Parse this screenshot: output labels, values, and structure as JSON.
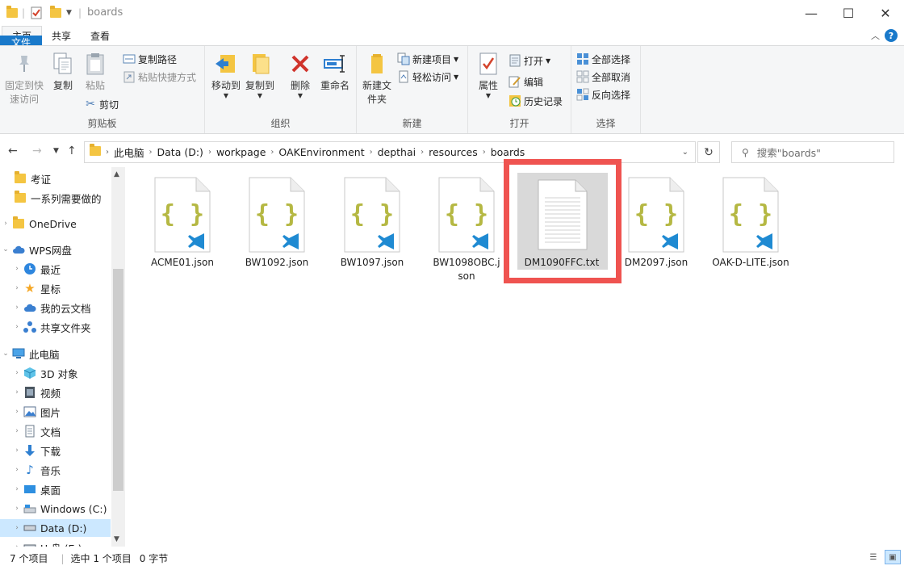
{
  "window": {
    "title": "boards",
    "minimize": "—",
    "maximize": "☐",
    "close": "✕"
  },
  "tabs": [
    {
      "label": "文件"
    },
    {
      "label": "主页"
    },
    {
      "label": "共享"
    },
    {
      "label": "查看"
    }
  ],
  "ribbon": {
    "clipboard": {
      "label": "剪贴板",
      "pin": "固定到快速访问",
      "copy": "复制",
      "paste": "粘贴",
      "copy_path": "复制路径",
      "paste_shortcut": "粘贴快捷方式",
      "cut": "剪切"
    },
    "organize": {
      "label": "组织",
      "move_to": "移动到",
      "copy_to": "复制到",
      "delete": "删除",
      "rename": "重命名"
    },
    "new": {
      "label": "新建",
      "new_folder": "新建文件夹",
      "new_item": "新建项目",
      "easy_access": "轻松访问"
    },
    "open": {
      "label": "打开",
      "properties": "属性",
      "open": "打开",
      "edit": "编辑",
      "history": "历史记录"
    },
    "select": {
      "label": "选择",
      "select_all": "全部选择",
      "select_none": "全部取消",
      "invert": "反向选择"
    }
  },
  "address": {
    "crumbs": [
      "此电脑",
      "Data (D:)",
      "workpage",
      "OAKEnvironment",
      "depthai",
      "resources",
      "boards"
    ],
    "search_placeholder": "搜索\"boards\""
  },
  "nav_tree": [
    {
      "label": "考证",
      "icon": "folder-icon"
    },
    {
      "label": "一系列需要做的",
      "icon": "folder-icon"
    },
    {
      "label": "OneDrive",
      "icon": "folder-icon"
    },
    {
      "label": "WPS网盘",
      "icon": "cloud-icon"
    },
    {
      "label": "最近",
      "icon": "clock-icon"
    },
    {
      "label": "星标",
      "icon": "star-icon"
    },
    {
      "label": "我的云文档",
      "icon": "cloud-icon"
    },
    {
      "label": "共享文件夹",
      "icon": "share-icon"
    },
    {
      "label": "此电脑",
      "icon": "computer-icon"
    },
    {
      "label": "3D 对象",
      "icon": "cube-icon"
    },
    {
      "label": "视频",
      "icon": "video-icon"
    },
    {
      "label": "图片",
      "icon": "picture-icon"
    },
    {
      "label": "文档",
      "icon": "document-icon"
    },
    {
      "label": "下载",
      "icon": "download-icon"
    },
    {
      "label": "音乐",
      "icon": "music-icon"
    },
    {
      "label": "桌面",
      "icon": "desktop-icon"
    },
    {
      "label": "Windows (C:)",
      "icon": "drive-icon"
    },
    {
      "label": "Data (D:)",
      "icon": "drive-icon"
    },
    {
      "label": "U 盘 (E:)",
      "icon": "drive-icon"
    }
  ],
  "files": [
    {
      "name": "ACME01.json",
      "type": "json"
    },
    {
      "name": "BW1092.json",
      "type": "json"
    },
    {
      "name": "BW1097.json",
      "type": "json"
    },
    {
      "name": "BW1098OBC.json",
      "type": "json"
    },
    {
      "name": "DM1090FFC.txt",
      "type": "txt"
    },
    {
      "name": "DM2097.json",
      "type": "json"
    },
    {
      "name": "OAK-D-LITE.json",
      "type": "json"
    }
  ],
  "status": {
    "count": "7 个项目",
    "selection": "选中 1 个项目",
    "size": "0 字节"
  },
  "colors": {
    "accent": "#1979ca",
    "selection_highlight": "#ef5350",
    "folder": "#f4c542",
    "json_brace": "#b5b843",
    "vscode_blue": "#1f8ad2"
  }
}
